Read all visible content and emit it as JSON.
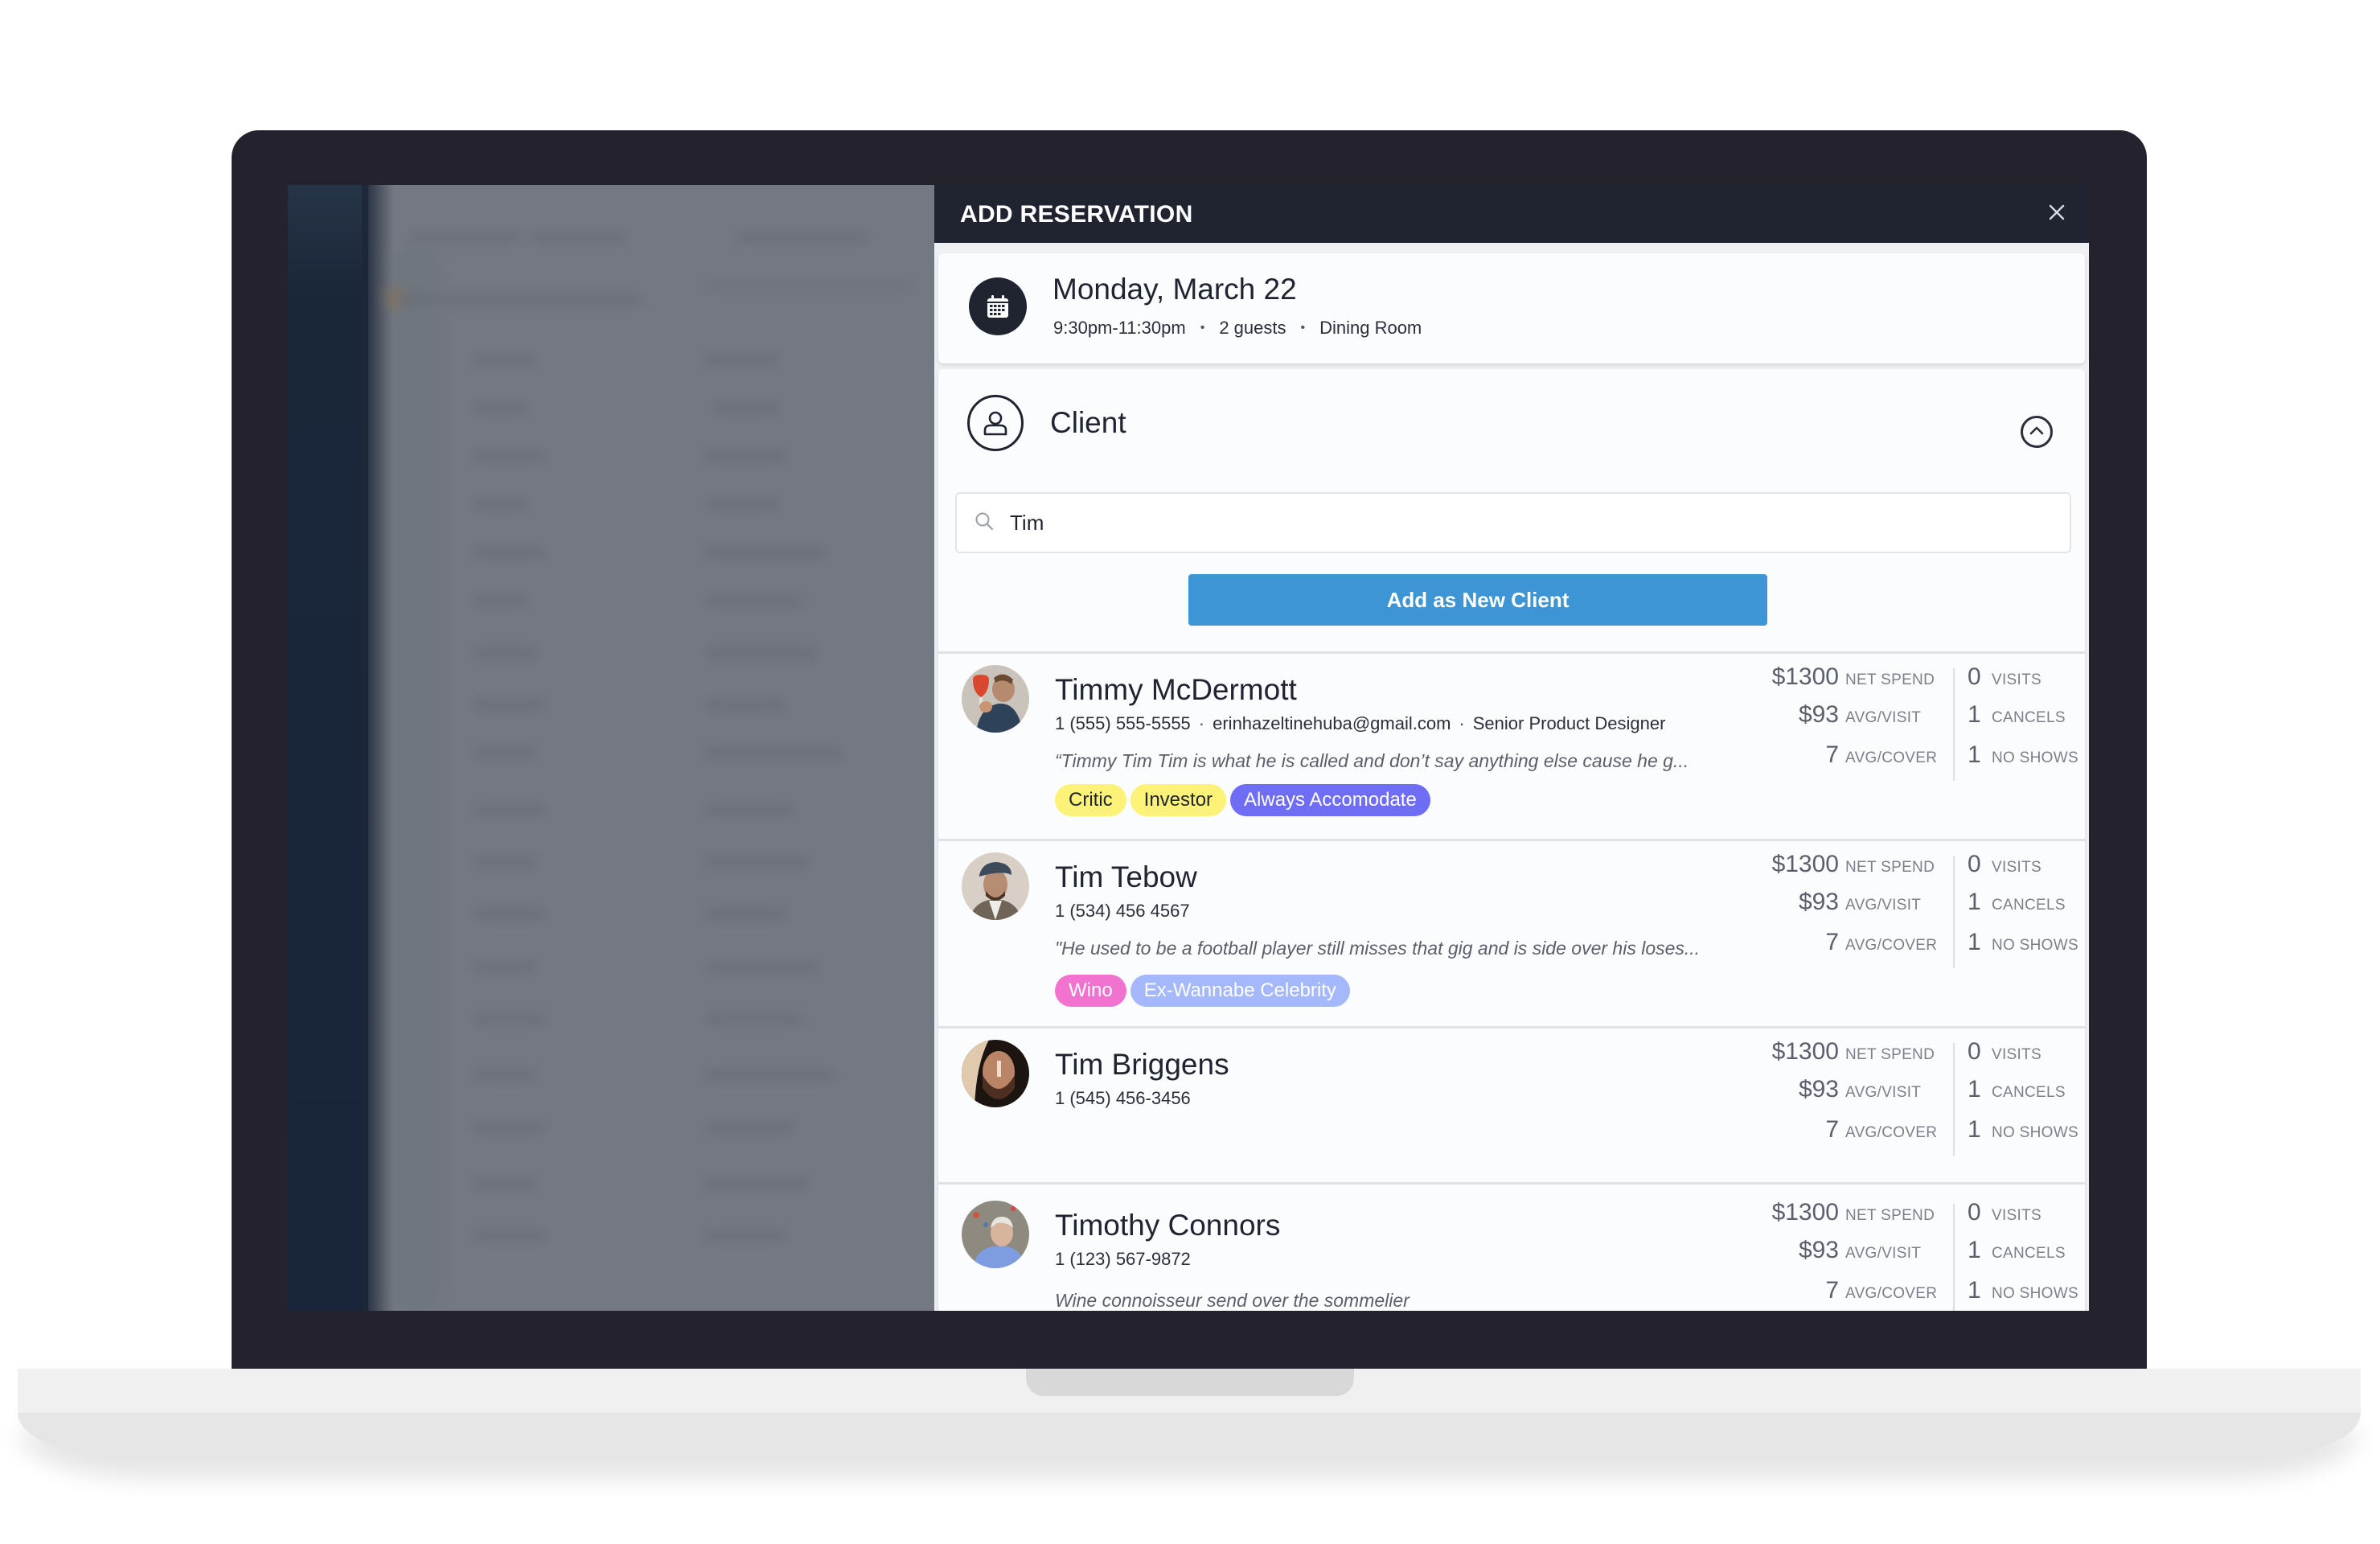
{
  "panel": {
    "title": "ADD RESERVATION",
    "close_icon": "close-icon"
  },
  "reservation": {
    "icon": "calendar-icon",
    "date": "Monday, March 22",
    "time": "9:30pm-11:30pm",
    "guests": "2 guests",
    "room": "Dining Room",
    "separator": "•"
  },
  "client_section": {
    "icon": "user-circle-icon",
    "title": "Client",
    "collapse_icon": "chevron-up-circle-icon",
    "search": {
      "icon": "search-icon",
      "value": "Tim",
      "placeholder": ""
    },
    "add_button_label": "Add as New Client"
  },
  "stat_labels": {
    "net_spend": "NET SPEND",
    "avg_visit": "AVG/VISIT",
    "avg_cover": "AVG/COVER",
    "visits": "VISITS",
    "cancels": "CANCELS",
    "no_shows": "NO SHOWS"
  },
  "tag_colors": {
    "yellow": {
      "bg": "#fdf278",
      "fg": "#1f2430"
    },
    "purple": {
      "bg": "#6f6cf5",
      "fg": "#ffffff"
    },
    "pink": {
      "bg": "#f272cf",
      "fg": "#ffffff"
    },
    "lavender": {
      "bg": "#a4b8fb",
      "fg": "#ffffff"
    }
  },
  "clients": [
    {
      "name": "Timmy McDermott",
      "phone": "1 (555) 555-5555",
      "email": "erinhazeltinehuba@gmail.com",
      "title": "Senior Product Designer",
      "note": "“Timmy Tim Tim is what he is called and don’t say anything else cause he g...",
      "tags": [
        {
          "label": "Critic",
          "color": "yellow"
        },
        {
          "label": "Investor",
          "color": "yellow"
        },
        {
          "label": "Always Accomodate",
          "color": "purple"
        }
      ],
      "stats": {
        "net_spend": "$1300",
        "avg_visit": "$93",
        "avg_cover": "7",
        "visits": "0",
        "cancels": "1",
        "no_shows": "1"
      }
    },
    {
      "name": "Tim Tebow",
      "phone": "1 (534) 456 4567",
      "note": "\"He used to be a football player still misses that gig and is side over his loses...",
      "tags": [
        {
          "label": "Wino",
          "color": "pink"
        },
        {
          "label": "Ex-Wannabe Celebrity",
          "color": "lavender"
        }
      ],
      "stats": {
        "net_spend": "$1300",
        "avg_visit": "$93",
        "avg_cover": "7",
        "visits": "0",
        "cancels": "1",
        "no_shows": "1"
      }
    },
    {
      "name": "Tim Briggens",
      "phone": "1 (545) 456-3456",
      "stats": {
        "net_spend": "$1300",
        "avg_visit": "$93",
        "avg_cover": "7",
        "visits": "0",
        "cancels": "1",
        "no_shows": "1"
      }
    },
    {
      "name": "Timothy Connors",
      "phone": "1 (123) 567-9872",
      "note": "Wine connoisseur send over the sommelier",
      "stats": {
        "net_spend": "$1300",
        "avg_visit": "$93",
        "avg_cover": "7",
        "visits": "0",
        "cancels": "1",
        "no_shows": "1"
      }
    }
  ]
}
